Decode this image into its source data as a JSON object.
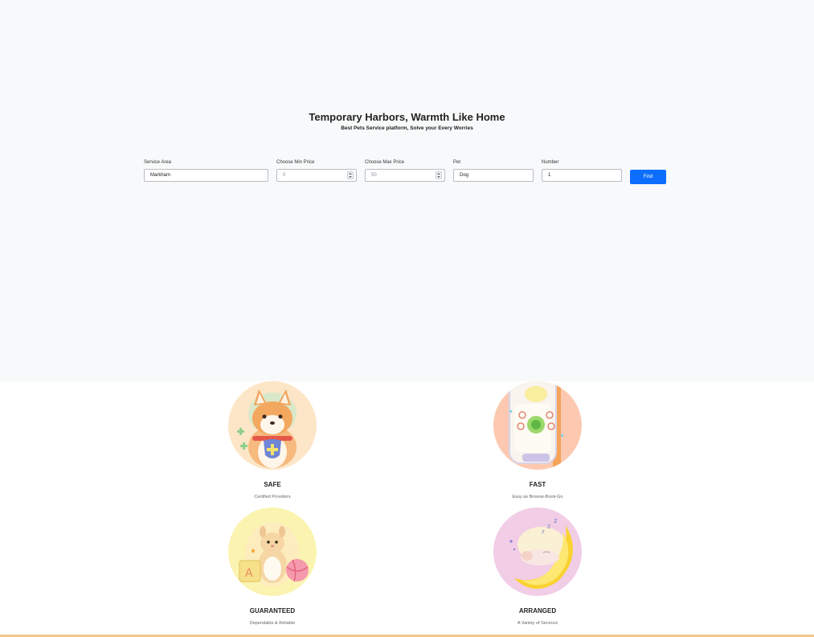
{
  "hero": {
    "title": "Temporary Harbors, Warmth Like Home",
    "subtitle": "Best Pets Service platform, Solve your Every Worries"
  },
  "search": {
    "service_area": {
      "label": "Service Area",
      "value": "Markham"
    },
    "min_price": {
      "label": "Choose Min Price",
      "value": "0"
    },
    "max_price": {
      "label": "Choose Max Price",
      "value": "50"
    },
    "pet": {
      "label": "Pet",
      "value": "Dog"
    },
    "number": {
      "label": "Number",
      "value": "1"
    },
    "find_label": "Find",
    "button_color": "#0d6efd"
  },
  "features": [
    {
      "title": "SAFE",
      "subtitle": "Certified Providers",
      "icon": "corgi-with-shield-icon",
      "bg": "#fde6c8"
    },
    {
      "title": "FAST",
      "subtitle": "Easy as Browse-Book-Go",
      "icon": "paw-phone-icon",
      "bg": "#fcc9b0"
    },
    {
      "title": "GUARANTEED",
      "subtitle": "Dependable & Reliable",
      "icon": "hamster-with-toys-icon",
      "bg": "#fbf3b0"
    },
    {
      "title": "ARRANGED",
      "subtitle": "A Variety of Services",
      "icon": "sleeping-pet-moon-icon",
      "bg": "#f1cde6"
    }
  ]
}
